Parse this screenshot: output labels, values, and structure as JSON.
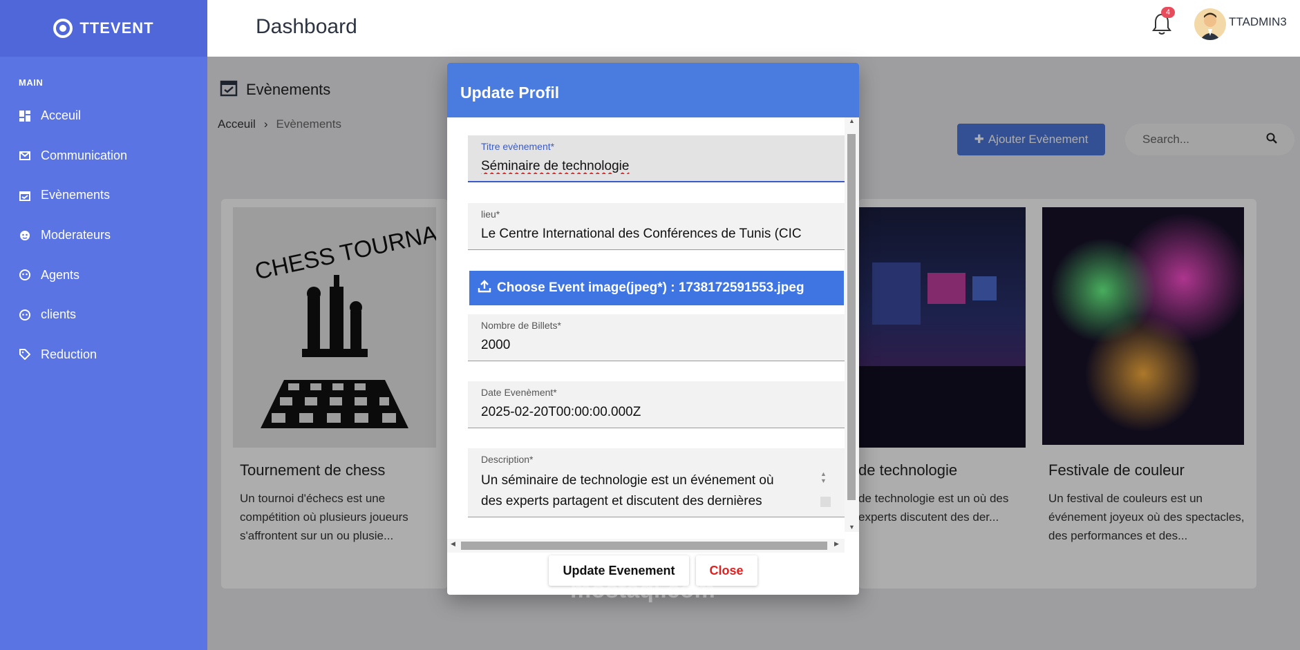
{
  "brand": {
    "name": "TTEVENT"
  },
  "sidebar": {
    "section": "MAIN",
    "items": [
      {
        "label": "Acceuil",
        "icon": "dashboard-icon"
      },
      {
        "label": "Communication",
        "icon": "mail-icon"
      },
      {
        "label": "Evènements",
        "icon": "calendar-check-icon"
      },
      {
        "label": "Moderateurs",
        "icon": "moderator-icon"
      },
      {
        "label": "Agents",
        "icon": "agent-icon"
      },
      {
        "label": "clients",
        "icon": "client-icon"
      },
      {
        "label": "Reduction",
        "icon": "tag-icon"
      }
    ]
  },
  "header": {
    "title": "Dashboard",
    "notifications": "4",
    "username": "TTADMIN3"
  },
  "main": {
    "section_title": "Evènements",
    "breadcrumb": [
      "Acceuil",
      "Evènements"
    ],
    "add_button": "Ajouter Evènement",
    "search_placeholder": "Search...",
    "cards": [
      {
        "title": "Tournement de chess",
        "description": "Un tournoi d'échecs est une compétition où plusieurs joueurs s'affrontent sur un ou plusie..."
      },
      {
        "title": "de technologie",
        "description": "de technologie est un où des experts discutent des der..."
      },
      {
        "title": "Festivale de couleur",
        "description": "Un festival de couleurs est un événement joyeux où des spectacles, des performances et des..."
      }
    ]
  },
  "modal": {
    "title": "Update Profil",
    "fields": {
      "titre": {
        "label": "Titre evènement*",
        "value": "Séminaire de technologie"
      },
      "lieu": {
        "label": "lieu*",
        "value": "Le Centre International des Conférences de Tunis (CIC"
      },
      "upload": "Choose Event image(jpeg*) : 1738172591553.jpeg",
      "billets": {
        "label": "Nombre de Billets*",
        "value": "2000"
      },
      "date": {
        "label": "Date Evenèment*",
        "value": "2025-02-20T00:00:00.000Z"
      },
      "description": {
        "label": "Description*",
        "line1": "Un séminaire de technologie est un événement où",
        "line2": "des experts partagent et discutent des dernières"
      }
    },
    "update_button": "Update Evenement",
    "close_button": "Close"
  },
  "watermark": "mostaql.com",
  "colors": {
    "sidebar": "#5b74e3",
    "accent": "#4a7ce0",
    "danger": "#dd2222"
  }
}
